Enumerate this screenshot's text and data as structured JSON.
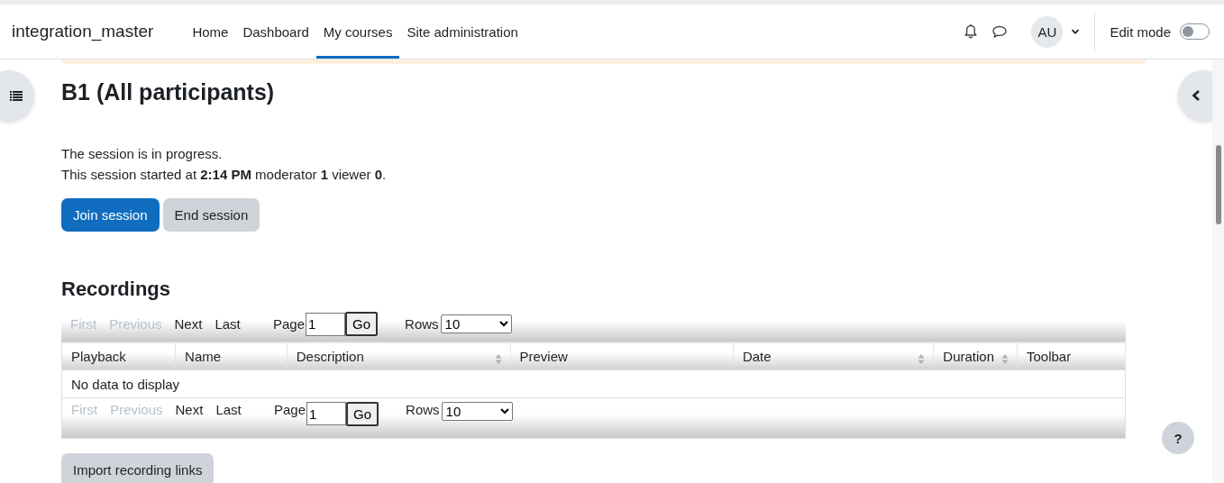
{
  "navbar": {
    "brand": "integration_master",
    "items": [
      {
        "label": "Home",
        "selected": false
      },
      {
        "label": "Dashboard",
        "selected": false
      },
      {
        "label": "My courses",
        "selected": true
      },
      {
        "label": "Site administration",
        "selected": false
      }
    ],
    "avatar": "AU",
    "edit_mode": {
      "label": "Edit mode",
      "on": false
    }
  },
  "session": {
    "title": "B1 (All participants)",
    "lines": [
      "The session is in progress.",
      "This session started at **2:14 PM** moderator **1** viewer **0**."
    ],
    "buttons": [
      {
        "label": "Join session",
        "kind": "primary"
      },
      {
        "label": "End session",
        "kind": "secondary"
      }
    ]
  },
  "recordings": {
    "title": "Recordings",
    "pagers": [
      {
        "links": [
          {
            "label": "First",
            "disabled": true
          },
          {
            "label": "Previous",
            "disabled": true
          },
          {
            "label": "Next",
            "disabled": false
          },
          {
            "label": "Last",
            "disabled": false
          }
        ],
        "page_label": "Page",
        "page_value": "1",
        "go": "Go",
        "rows_label": "Rows",
        "rows_value": "10"
      },
      {
        "links": [
          {
            "label": "First",
            "disabled": true
          },
          {
            "label": "Previous",
            "disabled": true
          },
          {
            "label": "Next",
            "disabled": false
          },
          {
            "label": "Last",
            "disabled": false
          }
        ],
        "page_label": "Page",
        "page_value": "1",
        "go": "Go",
        "rows_label": "Rows",
        "rows_value": "10"
      }
    ],
    "columns": [
      {
        "label": "Playback",
        "sortable": false
      },
      {
        "label": "Name",
        "sortable": false
      },
      {
        "label": "Description",
        "sortable": true
      },
      {
        "label": "Preview",
        "sortable": false
      },
      {
        "label": "Date",
        "sortable": true
      },
      {
        "label": "Duration",
        "sortable": true
      },
      {
        "label": "Toolbar",
        "sortable": false
      }
    ],
    "empty": "No data to display",
    "import_button": "Import recording links"
  },
  "help": "?"
}
